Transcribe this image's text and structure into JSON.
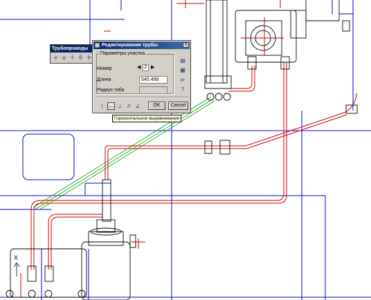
{
  "toolbar": {
    "title": "Трубопроводы",
    "buttons": [
      "pipe-tool-1-icon",
      "pipe-tool-2-icon",
      "pipe-tool-3-icon",
      "pipe-tool-4-icon",
      "pipe-tool-5-icon"
    ]
  },
  "dialog": {
    "title": "Редактирование трубы",
    "close_glyph": "×",
    "group_label": "Параметры участка",
    "number_label": "Номер",
    "number_value": "2",
    "length_label": "Длина",
    "length_value": "545.458",
    "radius_label": "Радиус гиба",
    "radius_value": "",
    "ok_label": "OK",
    "cancel_label": "Cancel",
    "align_icons": [
      "vertical-align-icon",
      "horizontal-align-icon",
      "perpendicular-align-icon",
      "parallel-align-icon",
      "angle-align-icon"
    ]
  },
  "tooltip": "Горизонтальное выравнивание",
  "drawing": {
    "axis_label": "X",
    "colors": {
      "frame": "#0000cc",
      "pipe": "#cc0000",
      "green": "#009900",
      "equipment": "#000000",
      "background": "#ffffff"
    }
  }
}
